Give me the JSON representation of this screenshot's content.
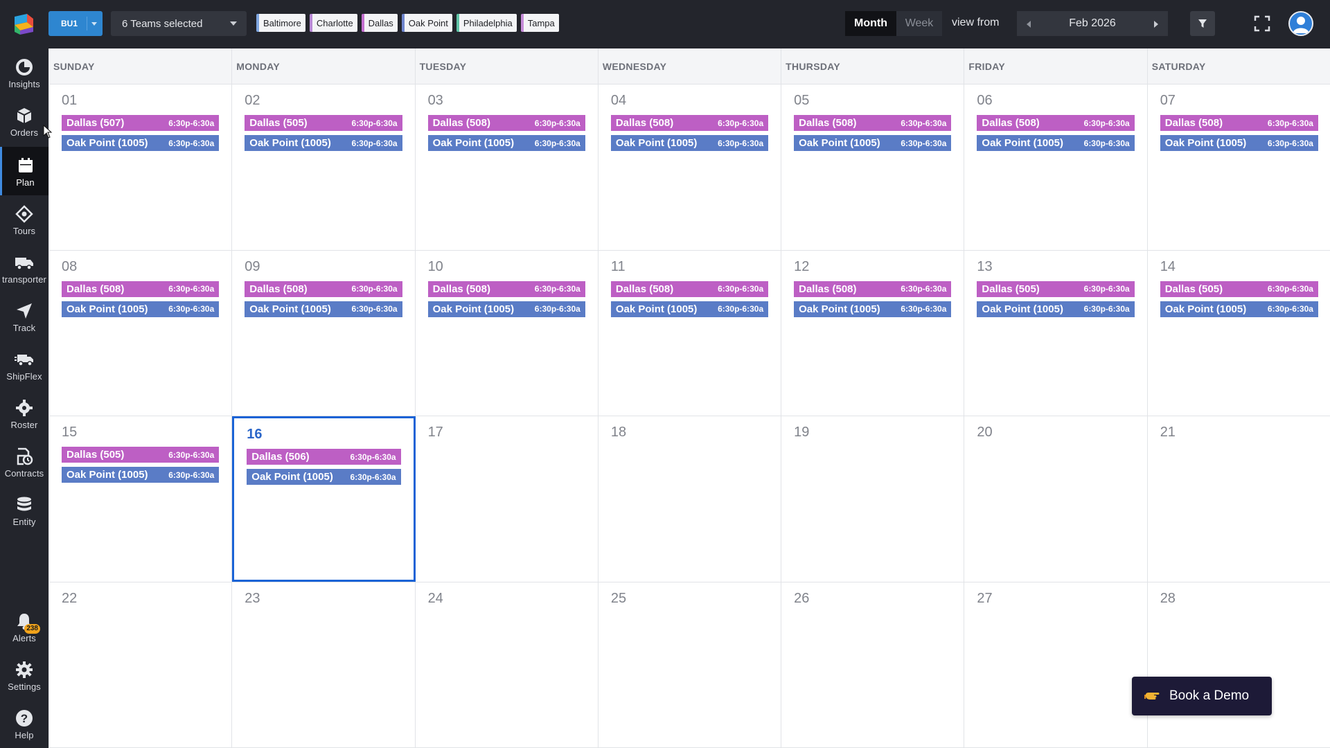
{
  "sidebar": {
    "items": [
      {
        "label": "Insights",
        "icon": "insights-icon"
      },
      {
        "label": "Orders",
        "icon": "box-icon"
      },
      {
        "label": "Plan",
        "icon": "calendar-icon",
        "active": true
      },
      {
        "label": "Tours",
        "icon": "tours-icon"
      },
      {
        "label": "transporter",
        "icon": "truck-icon"
      },
      {
        "label": "Track",
        "icon": "navigation-icon"
      },
      {
        "label": "ShipFlex",
        "icon": "shipflex-truck-icon"
      },
      {
        "label": "Roster",
        "icon": "roster-gear-icon"
      },
      {
        "label": "Contracts",
        "icon": "contract-clock-icon"
      },
      {
        "label": "Entity",
        "icon": "database-icon"
      }
    ],
    "bottom": [
      {
        "label": "Alerts",
        "icon": "bell-icon",
        "badge": "238"
      },
      {
        "label": "Settings",
        "icon": "gear-icon"
      },
      {
        "label": "Help",
        "icon": "help-icon"
      }
    ]
  },
  "topbar": {
    "bu_label": "BU1",
    "teams_label": "6 Teams selected",
    "chips": [
      {
        "label": "Baltimore",
        "color": "#7fa6e0"
      },
      {
        "label": "Charlotte",
        "color": "#b98ad6"
      },
      {
        "label": "Dallas",
        "color": "#c46fd0"
      },
      {
        "label": "Oak Point",
        "color": "#6f86cf"
      },
      {
        "label": "Philadelphia",
        "color": "#5fc3a6"
      },
      {
        "label": "Tampa",
        "color": "#c58bd8"
      }
    ],
    "view_month": "Month",
    "view_week": "Week",
    "view_from": "view from",
    "current_period": "Feb 2026",
    "accent_color": "#2e86d0"
  },
  "calendar": {
    "day_headers": [
      "SUNDAY",
      "MONDAY",
      "TUESDAY",
      "WEDNESDAY",
      "THURSDAY",
      "FRIDAY",
      "SATURDAY"
    ],
    "weeks": [
      [
        {
          "day": "01",
          "events": [
            {
              "name": "Dallas (507)",
              "time": "6:30p-6:30a",
              "type": "dallas"
            },
            {
              "name": "Oak Point (1005)",
              "time": "6:30p-6:30a",
              "type": "oak"
            }
          ]
        },
        {
          "day": "02",
          "events": [
            {
              "name": "Dallas (505)",
              "time": "6:30p-6:30a",
              "type": "dallas"
            },
            {
              "name": "Oak Point (1005)",
              "time": "6:30p-6:30a",
              "type": "oak"
            }
          ]
        },
        {
          "day": "03",
          "events": [
            {
              "name": "Dallas (508)",
              "time": "6:30p-6:30a",
              "type": "dallas"
            },
            {
              "name": "Oak Point (1005)",
              "time": "6:30p-6:30a",
              "type": "oak"
            }
          ]
        },
        {
          "day": "04",
          "events": [
            {
              "name": "Dallas (508)",
              "time": "6:30p-6:30a",
              "type": "dallas"
            },
            {
              "name": "Oak Point (1005)",
              "time": "6:30p-6:30a",
              "type": "oak"
            }
          ]
        },
        {
          "day": "05",
          "events": [
            {
              "name": "Dallas (508)",
              "time": "6:30p-6:30a",
              "type": "dallas"
            },
            {
              "name": "Oak Point (1005)",
              "time": "6:30p-6:30a",
              "type": "oak"
            }
          ]
        },
        {
          "day": "06",
          "events": [
            {
              "name": "Dallas (508)",
              "time": "6:30p-6:30a",
              "type": "dallas"
            },
            {
              "name": "Oak Point (1005)",
              "time": "6:30p-6:30a",
              "type": "oak"
            }
          ]
        },
        {
          "day": "07",
          "events": [
            {
              "name": "Dallas (508)",
              "time": "6:30p-6:30a",
              "type": "dallas"
            },
            {
              "name": "Oak Point (1005)",
              "time": "6:30p-6:30a",
              "type": "oak"
            }
          ]
        }
      ],
      [
        {
          "day": "08",
          "events": [
            {
              "name": "Dallas (508)",
              "time": "6:30p-6:30a",
              "type": "dallas"
            },
            {
              "name": "Oak Point (1005)",
              "time": "6:30p-6:30a",
              "type": "oak"
            }
          ]
        },
        {
          "day": "09",
          "events": [
            {
              "name": "Dallas (508)",
              "time": "6:30p-6:30a",
              "type": "dallas"
            },
            {
              "name": "Oak Point (1005)",
              "time": "6:30p-6:30a",
              "type": "oak"
            }
          ]
        },
        {
          "day": "10",
          "events": [
            {
              "name": "Dallas (508)",
              "time": "6:30p-6:30a",
              "type": "dallas"
            },
            {
              "name": "Oak Point (1005)",
              "time": "6:30p-6:30a",
              "type": "oak"
            }
          ]
        },
        {
          "day": "11",
          "events": [
            {
              "name": "Dallas (508)",
              "time": "6:30p-6:30a",
              "type": "dallas"
            },
            {
              "name": "Oak Point (1005)",
              "time": "6:30p-6:30a",
              "type": "oak"
            }
          ]
        },
        {
          "day": "12",
          "events": [
            {
              "name": "Dallas (508)",
              "time": "6:30p-6:30a",
              "type": "dallas"
            },
            {
              "name": "Oak Point (1005)",
              "time": "6:30p-6:30a",
              "type": "oak"
            }
          ]
        },
        {
          "day": "13",
          "events": [
            {
              "name": "Dallas (505)",
              "time": "6:30p-6:30a",
              "type": "dallas"
            },
            {
              "name": "Oak Point (1005)",
              "time": "6:30p-6:30a",
              "type": "oak"
            }
          ]
        },
        {
          "day": "14",
          "events": [
            {
              "name": "Dallas (505)",
              "time": "6:30p-6:30a",
              "type": "dallas"
            },
            {
              "name": "Oak Point (1005)",
              "time": "6:30p-6:30a",
              "type": "oak"
            }
          ]
        }
      ],
      [
        {
          "day": "15",
          "events": [
            {
              "name": "Dallas (505)",
              "time": "6:30p-6:30a",
              "type": "dallas"
            },
            {
              "name": "Oak Point (1005)",
              "time": "6:30p-6:30a",
              "type": "oak"
            }
          ]
        },
        {
          "day": "16",
          "today": true,
          "events": [
            {
              "name": "Dallas (506)",
              "time": "6:30p-6:30a",
              "type": "dallas"
            },
            {
              "name": "Oak Point (1005)",
              "time": "6:30p-6:30a",
              "type": "oak"
            }
          ]
        },
        {
          "day": "17",
          "events": []
        },
        {
          "day": "18",
          "events": []
        },
        {
          "day": "19",
          "events": []
        },
        {
          "day": "20",
          "events": []
        },
        {
          "day": "21",
          "events": []
        }
      ],
      [
        {
          "day": "22",
          "events": []
        },
        {
          "day": "23",
          "events": []
        },
        {
          "day": "24",
          "events": []
        },
        {
          "day": "25",
          "events": []
        },
        {
          "day": "26",
          "events": []
        },
        {
          "day": "27",
          "events": []
        },
        {
          "day": "28",
          "events": []
        }
      ]
    ]
  },
  "demo": {
    "label": "Book a Demo",
    "icon": "pointing-hand-icon"
  }
}
